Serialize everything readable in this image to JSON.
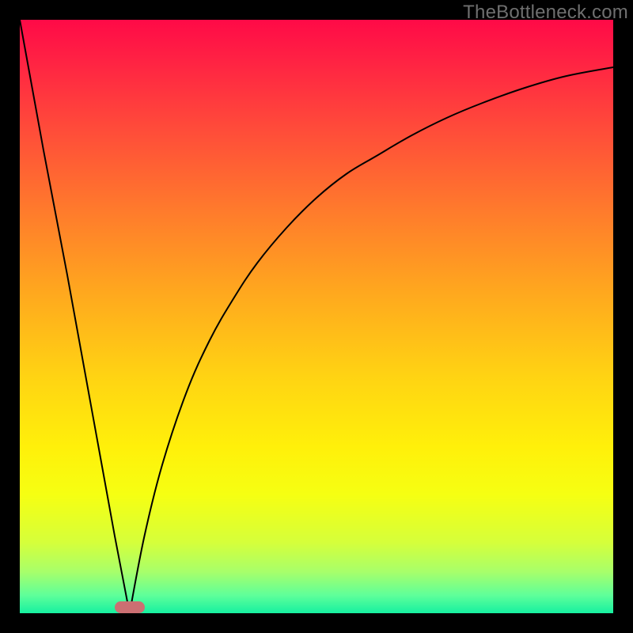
{
  "watermark": "TheBottleneck.com",
  "colors": {
    "marker": "#cc6f72",
    "curve_stroke": "#000000"
  },
  "chart_data": {
    "type": "line",
    "title": "",
    "xlabel": "",
    "ylabel": "",
    "xlim": [
      0,
      100
    ],
    "ylim": [
      0,
      100
    ],
    "grid": false,
    "legend": false,
    "description": "Bottleneck / mismatch percentage curve. Horizontal axis corresponds to some normalized component ratio (0–100); vertical axis is bottleneck percentage (0–100). Curve drops sharply from ~100% at x≈0 to 0% near x≈18.5, then rises along a concave diminishing-return curve back toward ~92% at x=100. A highlighted oval marker sits at the minimum (x≈18.5, y≈0). Background gradient encodes the same value: red at top (high bottleneck) through yellow to green at bottom (no bottleneck).",
    "notch_x": 18.5,
    "series": [
      {
        "name": "bottleneck",
        "x": [
          0,
          4,
          8,
          12,
          16,
          18.5,
          21,
          24,
          28,
          32,
          36,
          40,
          45,
          50,
          55,
          60,
          66,
          72,
          78,
          85,
          92,
          100
        ],
        "y": [
          100,
          78,
          57,
          35,
          13,
          0,
          13,
          25,
          37,
          46,
          53,
          59,
          65,
          70,
          74,
          77,
          80.5,
          83.5,
          86,
          88.5,
          90.5,
          92
        ]
      }
    ],
    "marker": {
      "x": 18.5,
      "y": 0
    }
  }
}
